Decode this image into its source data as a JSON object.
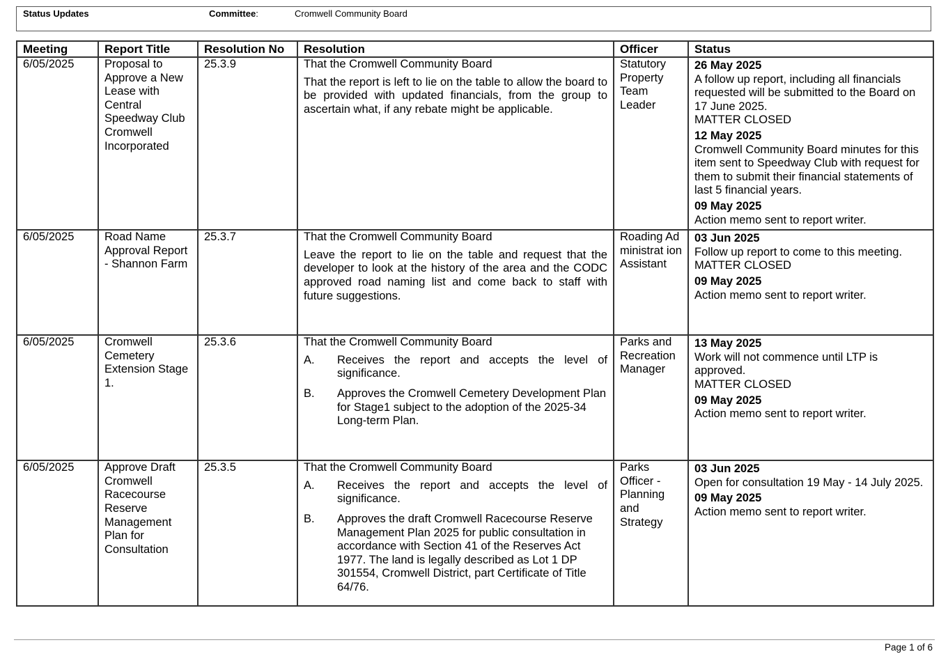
{
  "header": {
    "title": "Status Updates",
    "committee_label": "Committee",
    "committee_colon": ":",
    "committee_value": "Cromwell Community Board"
  },
  "table": {
    "columns": [
      "Meeting",
      "Report Title",
      "Resolution No",
      "Resolution",
      "Officer",
      "Status"
    ],
    "rows": [
      {
        "meeting": "6/05/2025",
        "report_title": "Proposal to Approve a New Lease with Central Speedway Club Cromwell Incorporated",
        "resolution_no": "25.3.9",
        "resolution_lead": "That the Cromwell Community Board",
        "resolution_text": "That the report is left to lie on the table to allow the board to be provided with updated financials, from the group to ascertain what, if any rebate might be applicable.",
        "officer": "Statutory Property Team Leader",
        "status": [
          {
            "date": "26 May 2025",
            "lines": [
              "A follow up report, including all financials requested will be submitted to the Board on 17 June 2025.",
              "MATTER CLOSED"
            ]
          },
          {
            "date": "12 May 2025",
            "lines": [
              "Cromwell Community Board minutes for this item sent to Speedway Club with request for them to submit their financial statements of last 5 financial years."
            ]
          },
          {
            "date": "09 May 2025",
            "lines": [
              "Action memo sent to report writer."
            ]
          }
        ]
      },
      {
        "meeting": "6/05/2025",
        "report_title": "Road Name Approval Report - Shannon Farm",
        "resolution_no": "25.3.7",
        "resolution_lead": "That the Cromwell Community Board",
        "resolution_text": "Leave the report to lie on the table and request that the developer to look at the history of the area and the CODC approved road naming list and come back to staff with future suggestions.",
        "officer": "Roading Administrat ion Assistant",
        "status": [
          {
            "date": "03 Jun 2025",
            "lines": [
              "Follow up report to come to this meeting.",
              "MATTER CLOSED"
            ]
          },
          {
            "date": "09 May 2025",
            "lines": [
              "Action memo sent to report writer."
            ]
          }
        ]
      },
      {
        "meeting": "6/05/2025",
        "report_title": "Cromwell Cemetery Extension Stage 1.",
        "resolution_no": "25.3.6",
        "resolution_lead": "That the Cromwell Community Board",
        "resolution_items": [
          {
            "letter": "A.",
            "text": "Receives the report and accepts the level of significance."
          },
          {
            "letter": "B.",
            "text": "Approves the Cromwell Cemetery Development Plan for Stage1 subject to the adoption of the 2025-34 Long-term Plan."
          }
        ],
        "officer": "Parks and Recreation Manager",
        "status": [
          {
            "date": "13 May 2025",
            "lines": [
              "Work will not commence until LTP is approved.",
              "MATTER CLOSED"
            ]
          },
          {
            "date": "09 May 2025",
            "lines": [
              "Action memo sent to report writer."
            ]
          }
        ]
      },
      {
        "meeting": "6/05/2025",
        "report_title": "Approve Draft Cromwell Racecourse Reserve Management Plan for Consultation",
        "resolution_no": "25.3.5",
        "resolution_lead": "That the Cromwell Community Board",
        "resolution_items": [
          {
            "letter": "A.",
            "text": "Receives the report and accepts the level of significance."
          },
          {
            "letter": "B.",
            "text": "Approves the draft Cromwell Racecourse Reserve Management Plan 2025 for public consultation in accordance with Section 41 of the Reserves Act 1977. The land is legally described as Lot 1 DP 301554, Cromwell District, part Certificate of Title 64/76."
          }
        ],
        "officer": "Parks Officer - Planning and Strategy",
        "status": [
          {
            "date": "03 Jun 2025",
            "lines": [
              "Open for consultation 19 May - 14 July 2025."
            ]
          },
          {
            "date": "09 May 2025",
            "lines": [
              "Action memo sent to report writer."
            ]
          }
        ]
      }
    ]
  },
  "footer": {
    "page_label": "Page 1 of 6"
  }
}
